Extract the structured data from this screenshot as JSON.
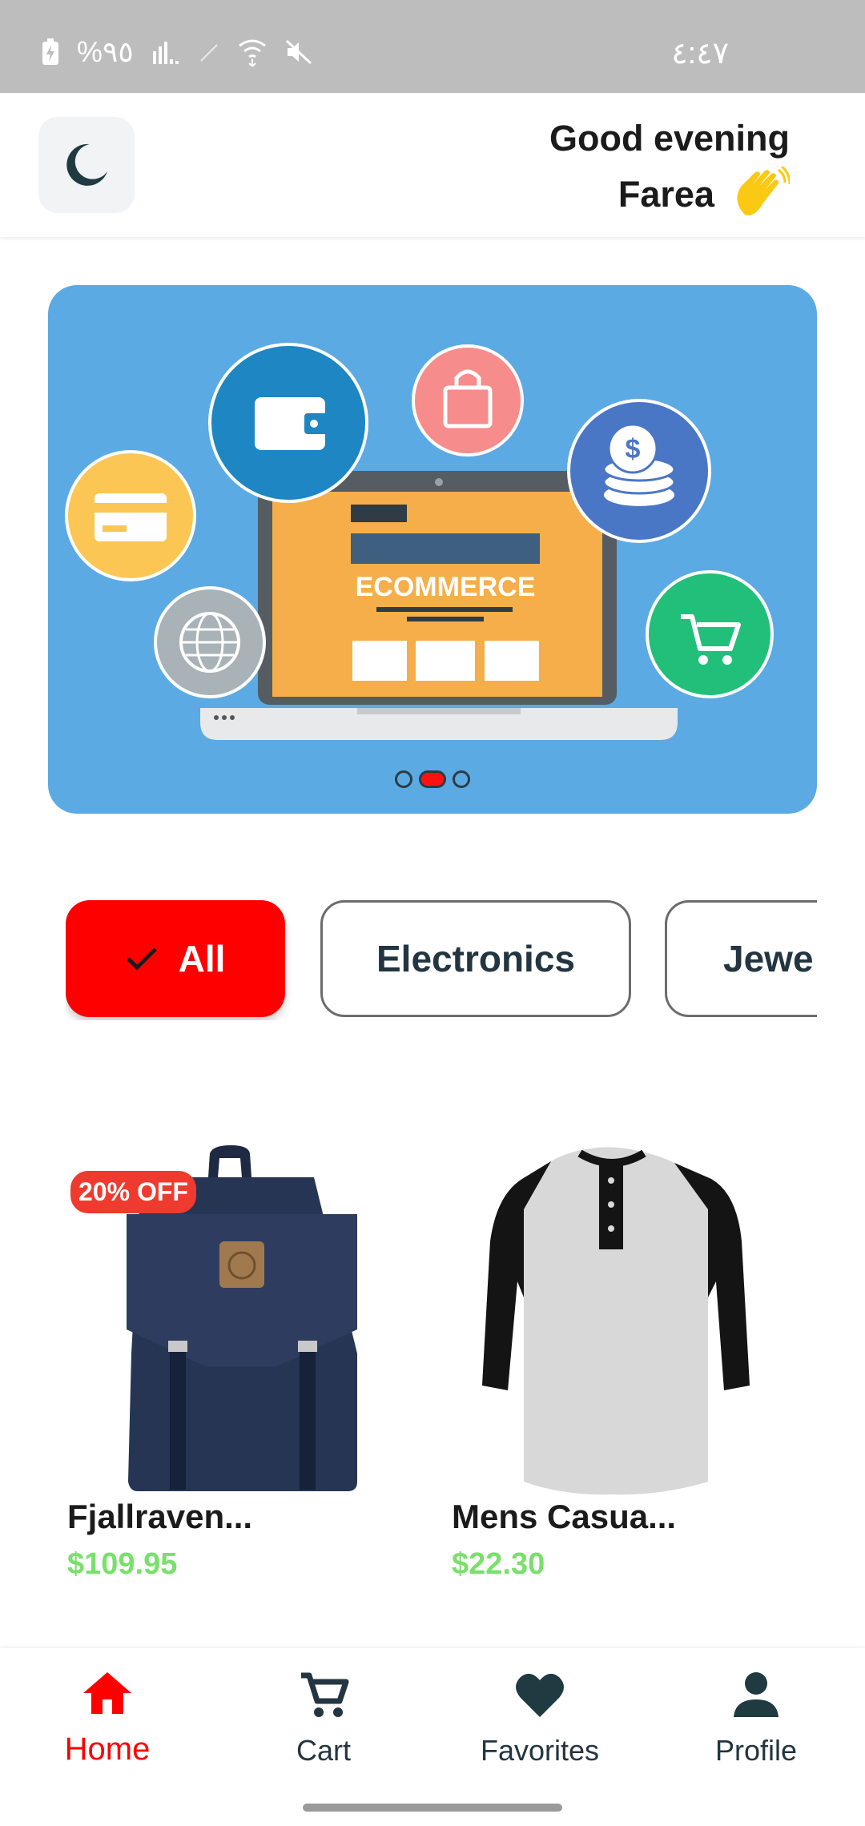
{
  "status_bar": {
    "battery": "%٩٥",
    "time": "٤:٤٧"
  },
  "header": {
    "greeting": "Good evening",
    "user_name": "Farea"
  },
  "banner": {
    "text": "ECOMMERCE",
    "slides": 3,
    "active_slide": 2
  },
  "categories": [
    {
      "label": "All",
      "selected": true
    },
    {
      "label": "Electronics",
      "selected": false
    },
    {
      "label": "Jewe",
      "selected": false
    }
  ],
  "products": [
    {
      "title": "Fjallraven...",
      "price": "$109.95",
      "badge": "20% OFF"
    },
    {
      "title": "Mens Casua...",
      "price": "$22.30"
    }
  ],
  "bottom_nav": [
    {
      "label": "Home",
      "icon": "home-icon",
      "active": true
    },
    {
      "label": "Cart",
      "icon": "cart-icon",
      "active": false
    },
    {
      "label": "Favorites",
      "icon": "heart-icon",
      "active": false
    },
    {
      "label": "Profile",
      "icon": "person-icon",
      "active": false
    }
  ],
  "colors": {
    "accent": "#ff0000",
    "banner_bg": "#5baae3",
    "price": "#79e06b",
    "dark": "#233540"
  }
}
